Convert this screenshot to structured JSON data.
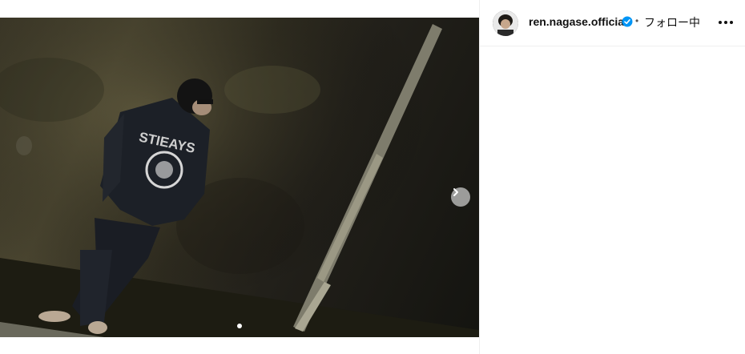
{
  "header": {
    "username": "ren.nagase.official",
    "separator": "•",
    "follow_label": "フォロー中"
  },
  "carousel": {
    "slide_count": 2,
    "active_index": 0
  },
  "icons": {
    "verified": "verified-badge-icon",
    "next": "chevron-right-icon",
    "more": "more-options-icon"
  },
  "colors": {
    "verified": "#0095f6"
  }
}
